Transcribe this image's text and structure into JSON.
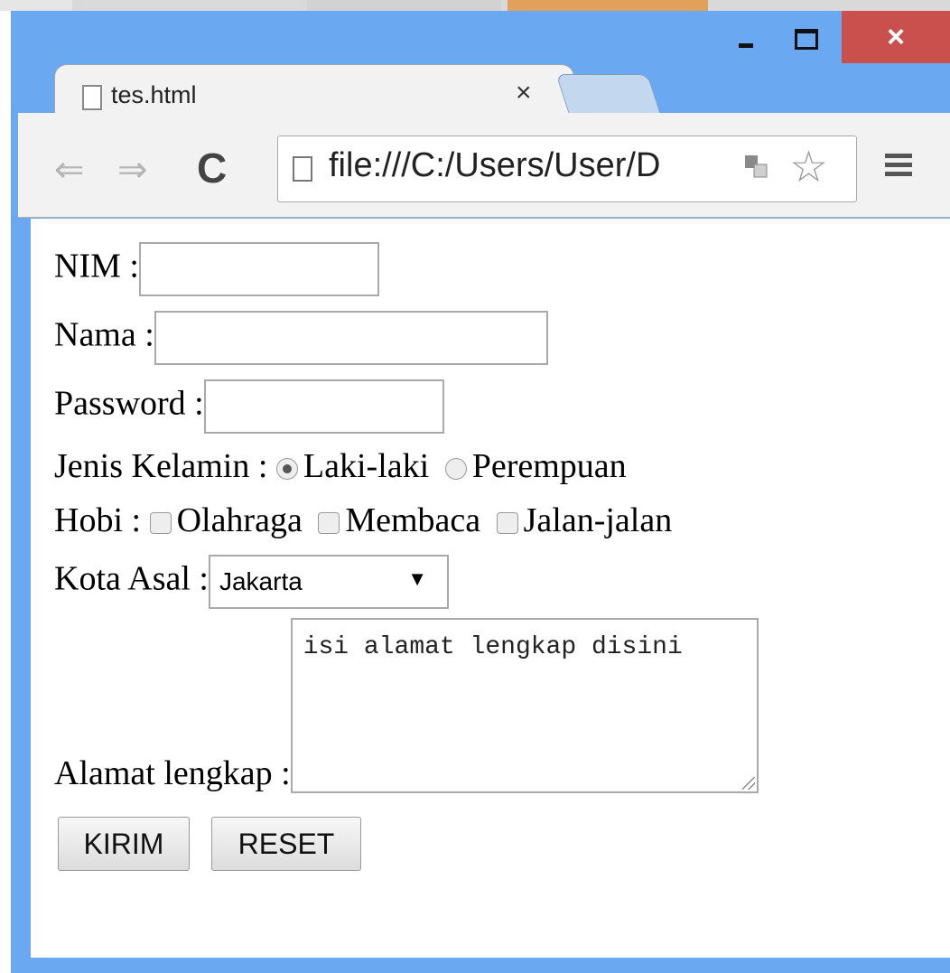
{
  "tab": {
    "title": "tes.html",
    "close_glyph": "×"
  },
  "window_controls": {
    "minimize": "minimize",
    "maximize": "maximize",
    "close_glyph": "×"
  },
  "toolbar": {
    "back_glyph": "⇐",
    "forward_glyph": "⇒",
    "reload_glyph": "C",
    "url": "file:///C:/Users/User/D",
    "star_glyph": "☆"
  },
  "form": {
    "nim_label": "NIM :",
    "nama_label": "Nama :",
    "password_label": "Password :",
    "gender_label": "Jenis Kelamin :",
    "gender_options": [
      "Laki-laki",
      "Perempuan"
    ],
    "gender_selected": "Laki-laki",
    "hobby_label": "Hobi :",
    "hobby_options": [
      "Olahraga",
      "Membaca",
      "Jalan-jalan"
    ],
    "city_label": "Kota Asal :",
    "city_selected": "Jakarta",
    "address_label": "Alamat lengkap :",
    "address_value": "isi alamat lengkap disini",
    "submit_label": "KIRIM",
    "reset_label": "RESET"
  },
  "colors": {
    "frame": "#6aa8f2",
    "close_button": "#c9504d",
    "tab_bg": "#f2f2f2",
    "newtab_bg": "#c3d7ef"
  },
  "icons": [
    "page-icon",
    "back-arrow-icon",
    "forward-arrow-icon",
    "reload-icon",
    "translate-icon",
    "star-icon",
    "menu-icon",
    "close-icon",
    "minimize-icon",
    "maximize-icon"
  ]
}
